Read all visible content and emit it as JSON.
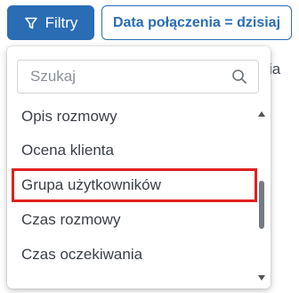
{
  "toolbar": {
    "filters_label": "Filtry",
    "filters_icon": "filter-icon",
    "date_filter_label": "Data połączenia = dzisiaj"
  },
  "background": {
    "partial_text": "ia"
  },
  "dropdown": {
    "search": {
      "placeholder": "Szukaj",
      "value": "",
      "icon": "search-icon"
    },
    "options": [
      {
        "label": "Opis rozmowy"
      },
      {
        "label": "Ocena klienta"
      },
      {
        "label": "Grupa użytkowników",
        "highlighted": true
      },
      {
        "label": "Czas rozmowy"
      },
      {
        "label": "Czas oczekiwania"
      }
    ]
  },
  "colors": {
    "accent": "#2a6db5",
    "highlight_border": "#e02020",
    "text": "#3a3f47"
  }
}
